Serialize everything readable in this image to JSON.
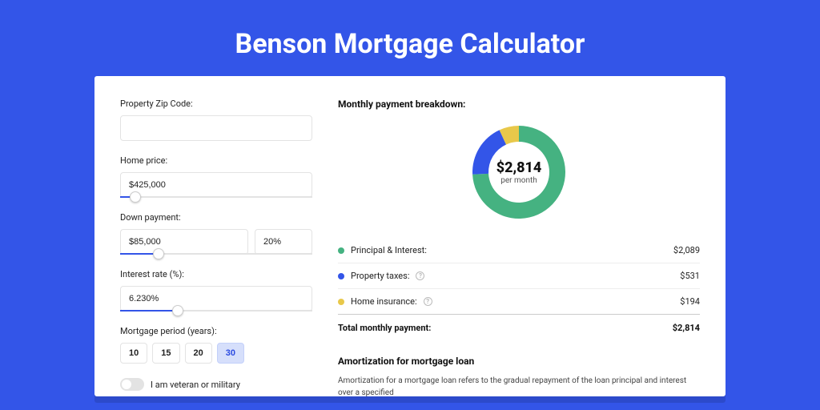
{
  "title": "Benson Mortgage Calculator",
  "form": {
    "zip_label": "Property Zip Code:",
    "zip_value": "",
    "home_price_label": "Home price:",
    "home_price_value": "$425,000",
    "home_price_slider_percent": 8,
    "down_payment_label": "Down payment:",
    "down_payment_value": "$85,000",
    "down_payment_percent_value": "20%",
    "down_payment_slider_percent": 20,
    "interest_label": "Interest rate (%):",
    "interest_value": "6.230%",
    "interest_slider_percent": 30,
    "period_label": "Mortgage period (years):",
    "periods": [
      "10",
      "15",
      "20",
      "30"
    ],
    "period_active_index": 3,
    "toggle_label": "I am veteran or military"
  },
  "breakdown": {
    "heading": "Monthly payment breakdown:",
    "center_amount": "$2,814",
    "center_sub": "per month",
    "items": [
      {
        "label": "Principal & Interest:",
        "value": "$2,089",
        "color": "green",
        "info": false
      },
      {
        "label": "Property taxes:",
        "value": "$531",
        "color": "blue",
        "info": true
      },
      {
        "label": "Home insurance:",
        "value": "$194",
        "color": "yellow",
        "info": true
      }
    ],
    "total_label": "Total monthly payment:",
    "total_value": "$2,814"
  },
  "amortization": {
    "heading": "Amortization for mortgage loan",
    "text": "Amortization for a mortgage loan refers to the gradual repayment of the loan principal and interest over a specified"
  },
  "chart_data": {
    "type": "pie",
    "title": "Monthly payment breakdown",
    "series": [
      {
        "name": "Principal & Interest",
        "value": 2089,
        "color": "#45b281"
      },
      {
        "name": "Property taxes",
        "value": 531,
        "color": "#3355e8"
      },
      {
        "name": "Home insurance",
        "value": 194,
        "color": "#e8c84a"
      }
    ],
    "total": 2814,
    "center_label": "$2,814 per month"
  },
  "colors": {
    "brand": "#3355e8",
    "green": "#45b281",
    "yellow": "#e8c84a"
  }
}
